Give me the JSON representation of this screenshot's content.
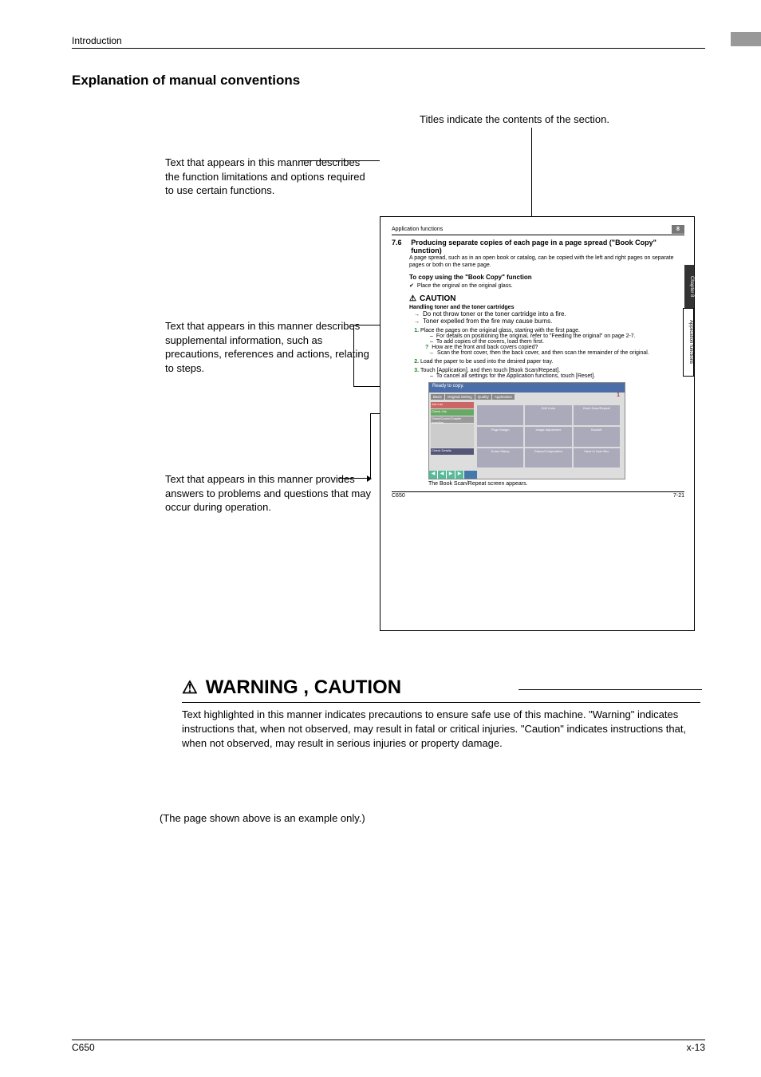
{
  "header": {
    "section": "Introduction"
  },
  "title": "Explanation of manual conventions",
  "callouts": {
    "titles": "Titles indicate the contents of the section.",
    "limitations": "Text that appears in this manner describes the function limitations and options required to use certain functions.",
    "supplemental": "Text that appears in this manner describes supplemental information, such as precautions, references and actions, relating to steps.",
    "answers": "Text that appears in this manner provides answers to problems and questions that may occur during operation."
  },
  "sample": {
    "header_label": "Application functions",
    "chapter_num": "8",
    "tab_chapter": "Chapter 8",
    "tab_side": "Application functions",
    "sec_num": "7.6",
    "sec_title": "Producing separate copies of each page in a page spread (\"Book Copy\" function)",
    "intro": "A page spread, such as in an open book or catalog, can be copied with the left and right pages on separate pages or both on the same page.",
    "subhead": "To copy using the \"Book Copy\" function",
    "check_line": "Place the original on the original glass.",
    "caution_label": "CAUTION",
    "caution_head": "Handling toner and the toner cartridges",
    "caution_l1": "Do not throw toner or the toner cartridge into a fire.",
    "caution_l2": "Toner expelled from the fire may cause burns.",
    "step1": "Place the pages on the original glass, starting with the first page.",
    "step1_d1": "For details on positioning the original, refer to \"Feeding the original\" on page 2-7.",
    "step1_d2": "To add copies of the covers, load them first.",
    "step1_q": "How are the front and back covers copied?",
    "step1_a": "Scan the front cover, then the back cover, and then scan the remainder of the original.",
    "step2": "Load the paper to be used into the desired paper tray.",
    "step3": "Touch [Application], and then touch [Book Scan/Repeat].",
    "step3_d1": "To cancel all settings for the Application functions, touch [Reset].",
    "screen": {
      "joblist": "Job List",
      "check": "Check Job",
      "ready": "Ready to copy.",
      "copies": "1",
      "tabs": [
        "Basic",
        "Original Setting",
        "Quality"
      ],
      "tab_red": "Application",
      "left1": "Sheet/Cover/Chapter Insertion",
      "left2": "Check Details",
      "grid": [
        "",
        "Edit Color",
        "Book Scan/Repeat",
        "",
        "",
        "",
        "Page Margin",
        "Image Adjustment",
        "Booklet",
        "Erase Stamp",
        "Stamp/Composition",
        "Save in User Box"
      ],
      "caption": "The Book Scan/Repeat screen appears."
    },
    "footer_model": "C650",
    "footer_page": "7-21"
  },
  "warning": {
    "title": "WARNING , CAUTION",
    "body": "Text highlighted in this manner indicates precautions to ensure safe use of this machine. \"Warning\" indicates instructions that, when not observed, may result in fatal or critical injuries. \"Caution\" indicates instructions that, when not observed, may result in serious injuries or property damage."
  },
  "example_note": "(The page shown above is an example only.)",
  "footer": {
    "model": "C650",
    "page": "x-13"
  }
}
